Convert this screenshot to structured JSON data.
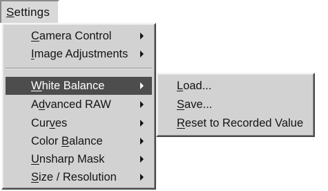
{
  "menubar": {
    "settings": {
      "pre": "",
      "ul": "S",
      "post": "ettings"
    }
  },
  "main_menu": {
    "items": [
      {
        "pre": "",
        "ul": "C",
        "post": "amera Control",
        "submenu": true
      },
      {
        "pre": "",
        "ul": "I",
        "post": "mage Adjustments",
        "submenu": true
      },
      {
        "pre": "",
        "ul": "W",
        "post": "hite Balance",
        "submenu": true,
        "selected": true
      },
      {
        "pre": "A",
        "ul": "d",
        "post": "vanced RAW",
        "submenu": true
      },
      {
        "pre": "Cur",
        "ul": "v",
        "post": "es",
        "submenu": true
      },
      {
        "pre": "Color ",
        "ul": "B",
        "post": "alance",
        "submenu": true
      },
      {
        "pre": "",
        "ul": "U",
        "post": "nsharp Mask",
        "submenu": true
      },
      {
        "pre": "",
        "ul": "S",
        "post": "ize / Resolution",
        "submenu": true
      }
    ]
  },
  "white_balance_menu": {
    "items": [
      {
        "pre": "",
        "ul": "L",
        "post": "oad..."
      },
      {
        "pre": "",
        "ul": "S",
        "post": "ave..."
      },
      {
        "pre": "",
        "ul": "R",
        "post": "eset to Recorded Value"
      }
    ]
  },
  "colors": {
    "menu_bg": "#d2d2d2",
    "highlight": "#4d4d4d",
    "highlight_text": "#ffffff"
  }
}
